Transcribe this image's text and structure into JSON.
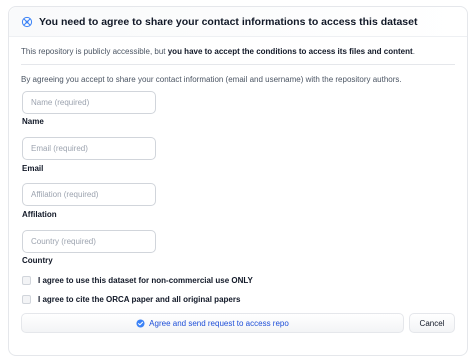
{
  "header": {
    "title": "You need to agree to share your contact informations to access this dataset",
    "icon": "gated-access-icon"
  },
  "intro": {
    "prefix": "This repository is publicly accessible, but ",
    "emphasis": "you have to accept the conditions to access its files and content",
    "suffix": "."
  },
  "agreement_note": "By agreeing you accept to share your contact information (email and username) with the repository authors.",
  "fields": [
    {
      "placeholder": "Name (required)",
      "value": "",
      "label": "Name"
    },
    {
      "placeholder": "Email (required)",
      "value": "",
      "label": "Email"
    },
    {
      "placeholder": "Affilation (required)",
      "value": "",
      "label": "Affilation"
    },
    {
      "placeholder": "Country (required)",
      "value": "",
      "label": "Country"
    }
  ],
  "checkboxes": [
    {
      "label": "I agree to use this dataset for non-commercial use ONLY",
      "checked": false
    },
    {
      "label": "I agree to cite the ORCA paper and all original papers",
      "checked": false
    }
  ],
  "buttons": {
    "submit_label": "Agree and send request to access repo",
    "submit_icon": "check-circle-icon",
    "cancel_label": "Cancel"
  },
  "colors": {
    "accent": "#1d4ed8",
    "icon_blue": "#3b82f6",
    "border": "#e5e7eb"
  }
}
